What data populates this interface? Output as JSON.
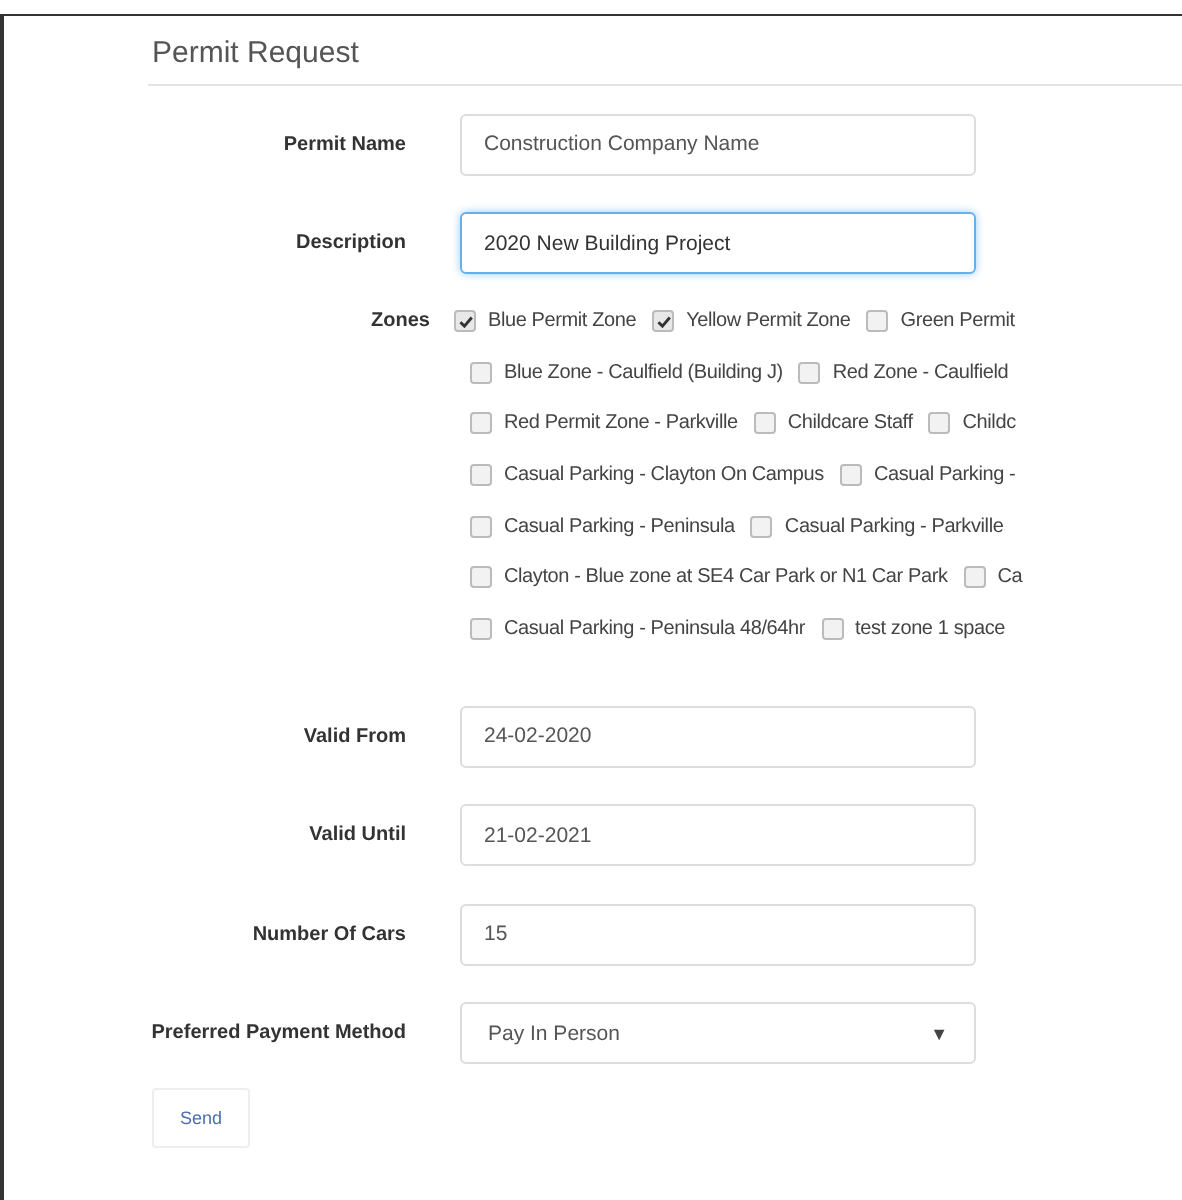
{
  "title": "Permit Request",
  "fields": [
    {
      "kind": "text",
      "label": "Permit Name",
      "value": "Construction Company Name",
      "focused": false
    },
    {
      "kind": "text",
      "label": "Description",
      "value": "2020 New Building Project",
      "focused": true
    }
  ],
  "zones": {
    "label": "Zones",
    "rows": [
      [
        {
          "label": "Blue Permit Zone",
          "checked": true
        },
        {
          "label": "Yellow Permit Zone",
          "checked": true
        },
        {
          "label": "Green Permit",
          "checked": false
        }
      ],
      [
        {
          "label": "Blue Zone - Caulfield (Building J)",
          "checked": false
        },
        {
          "label": "Red Zone - Caulfield",
          "checked": false
        }
      ],
      [
        {
          "label": "Red Permit Zone - Parkville",
          "checked": false
        },
        {
          "label": "Childcare Staff",
          "checked": false
        },
        {
          "label": "Childc",
          "checked": false
        }
      ],
      [
        {
          "label": "Casual Parking - Clayton On Campus",
          "checked": false
        },
        {
          "label": "Casual Parking -",
          "checked": false
        }
      ],
      [
        {
          "label": "Casual Parking - Peninsula",
          "checked": false
        },
        {
          "label": "Casual Parking - Parkville",
          "checked": false
        }
      ],
      [
        {
          "label": "Clayton - Blue zone at SE4 Car Park or N1 Car Park",
          "checked": false
        },
        {
          "label": "Ca",
          "checked": false
        }
      ],
      [
        {
          "label": "Casual Parking - Peninsula 48/64hr",
          "checked": false
        },
        {
          "label": "test zone 1 space",
          "checked": false
        }
      ]
    ]
  },
  "fields2": [
    {
      "kind": "text",
      "label": "Valid From",
      "value": "24-02-2020",
      "focused": false
    },
    {
      "kind": "text",
      "label": "Valid Until",
      "value": "21-02-2021",
      "focused": false
    },
    {
      "kind": "text",
      "label": "Number Of Cars",
      "value": "15",
      "focused": false
    },
    {
      "kind": "select",
      "label": "Preferred Payment Method",
      "value": "Pay In Person",
      "caret": "▼"
    }
  ],
  "send_button": "Send"
}
